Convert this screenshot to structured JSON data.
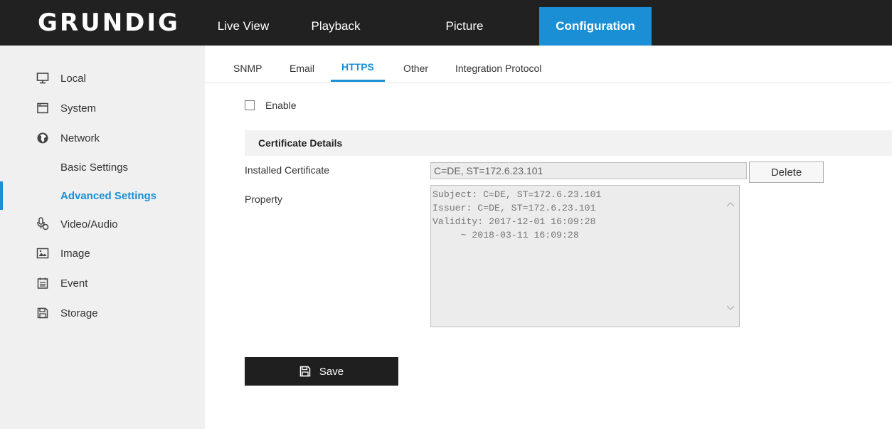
{
  "header": {
    "logo": "GRUNDIG",
    "nav": [
      {
        "label": "Live View"
      },
      {
        "label": "Playback"
      },
      {
        "label": "Picture"
      },
      {
        "label": "Configuration",
        "active": true
      }
    ]
  },
  "sidebar": {
    "items": [
      {
        "label": "Local",
        "icon": "monitor-icon"
      },
      {
        "label": "System",
        "icon": "window-icon"
      },
      {
        "label": "Network",
        "icon": "globe-icon"
      },
      {
        "label": "Basic Settings"
      },
      {
        "label": "Advanced Settings",
        "active": true
      },
      {
        "label": "Video/Audio",
        "icon": "microphone-icon"
      },
      {
        "label": "Image",
        "icon": "image-icon"
      },
      {
        "label": "Event",
        "icon": "calendar-icon"
      },
      {
        "label": "Storage",
        "icon": "floppy-icon"
      }
    ]
  },
  "tabs": [
    {
      "label": "SNMP"
    },
    {
      "label": "Email"
    },
    {
      "label": "HTTPS",
      "active": true
    },
    {
      "label": "Other"
    },
    {
      "label": "Integration Protocol"
    }
  ],
  "form": {
    "enable_label": "Enable",
    "enable_checked": false,
    "section_title": "Certificate Details",
    "installed_label": "Installed Certificate",
    "installed_value": "C=DE, ST=172.6.23.101",
    "delete_label": "Delete",
    "property_label": "Property",
    "property_value": "Subject: C=DE, ST=172.6.23.101\nIssuer: C=DE, ST=172.6.23.101\nValidity: 2017-12-01 16:09:28\n     ~ 2018-03-11 16:09:28",
    "save_label": "Save"
  },
  "colors": {
    "accent": "#1a8fd6",
    "header_bg": "#212121",
    "sidebar_bg": "#f0f0f0"
  }
}
